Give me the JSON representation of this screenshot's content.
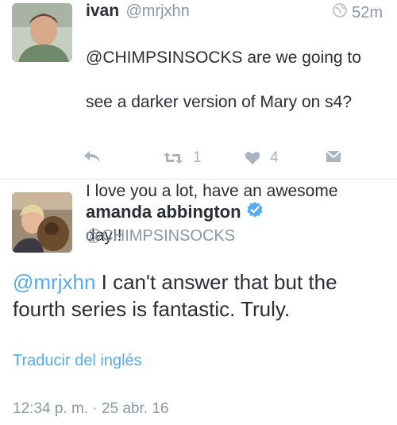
{
  "tweet1": {
    "name": "ivan",
    "handle": "@mrjxhn",
    "time": "52m",
    "text_line1": "@CHIMPSINSOCKS are we going to",
    "text_line2": "see a darker version of Mary on s4?",
    "text_line3": "",
    "text_line4": "I love you a lot, have an awesome",
    "text_line5": "day!!",
    "retweet_count": "1",
    "like_count": "4",
    "icons": [
      "globe-icon",
      "reply-icon",
      "retweet-icon",
      "heart-icon",
      "direct-message-icon"
    ]
  },
  "tweet2": {
    "name": "amanda abbington",
    "verified": true,
    "handle": "@CHIMPSINSOCKS",
    "mention": "@mrjxhn",
    "text_rest": " I can't answer that but the fourth series is fantastic. Truly.",
    "translate_label": "Traducir del inglés",
    "timestamp": "12:34 p. m. · 25 abr. 16",
    "icons": [
      "verified-badge-icon"
    ]
  },
  "colors": {
    "link": "#55acee",
    "muted": "#8899a6",
    "icon_gray": "#a8b4bf",
    "text": "#292f33"
  }
}
